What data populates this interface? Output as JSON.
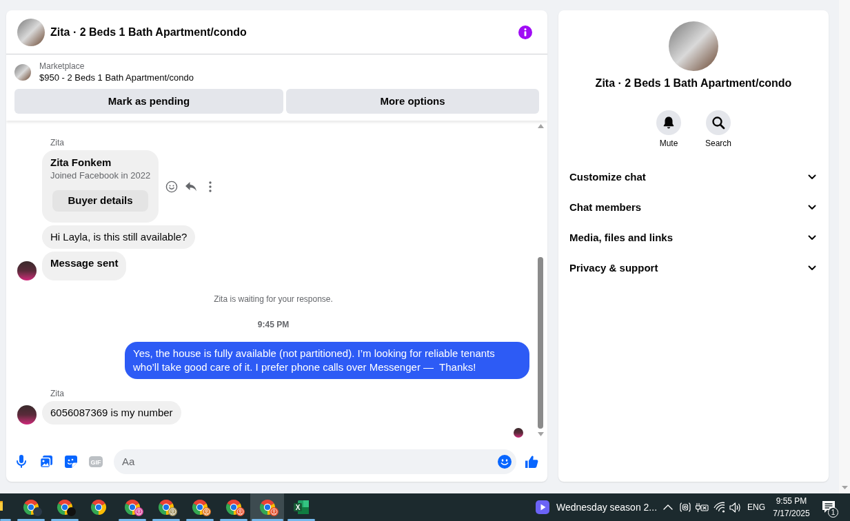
{
  "conversation": {
    "title": "Zita · 2 Beds 1 Bath Apartment/condo"
  },
  "listing": {
    "source": "Marketplace",
    "summary": "$950 - 2 Beds 1 Bath Apartment/condo",
    "actions": [
      "Mark as pending",
      "More options"
    ]
  },
  "messages": [
    {
      "kind": "sender",
      "text": "Zita"
    },
    {
      "kind": "card",
      "title": "Zita Fonkem",
      "subtitle": "Joined Facebook in 2022",
      "button": "Buyer details",
      "hovered": true
    },
    {
      "kind": "incoming",
      "text": "Hi Layla, is this still available?",
      "bold": false,
      "avatar": false,
      "seen": false
    },
    {
      "kind": "incoming",
      "text": "Message sent",
      "bold": true,
      "avatar": true,
      "seen": false
    },
    {
      "kind": "notice",
      "text": "Zita is waiting for your response."
    },
    {
      "kind": "time",
      "text": "9:45 PM"
    },
    {
      "kind": "outgoing",
      "text": "Yes, the house is fully available (not partitioned). I’m looking for reliable tenants who’ll take good care of it. I prefer phone calls over Messenger —  Thanks!"
    },
    {
      "kind": "sender",
      "text": "Zita"
    },
    {
      "kind": "incoming",
      "text": "6056087369 is my number",
      "bold": false,
      "avatar": true,
      "seen": true
    }
  ],
  "composer": {
    "tools": [
      {
        "kind": "voice"
      },
      {
        "kind": "photo"
      },
      {
        "kind": "sticker"
      },
      {
        "kind": "gif",
        "label": "GIF"
      }
    ],
    "placeholder": "Aa"
  },
  "details": {
    "title": "Zita · 2 Beds 1 Bath Apartment/condo",
    "actions": [
      {
        "kind": "mute",
        "label": "Mute"
      },
      {
        "kind": "search",
        "label": "Search"
      }
    ],
    "sections": [
      {
        "label": "Customize chat",
        "expanded": false
      },
      {
        "label": "Chat members",
        "expanded": false
      },
      {
        "label": "Media, files and links",
        "expanded": false
      },
      {
        "label": "Privacy & support",
        "expanded": false
      }
    ]
  },
  "taskbar": {
    "apps": [
      {
        "kind": "folder",
        "running": true,
        "selected": false
      },
      {
        "kind": "browser",
        "badge": {
          "kind": "photo",
          "color": "#2b3a4a"
        },
        "running": true,
        "selected": false
      },
      {
        "kind": "browser",
        "badge": {
          "kind": "photo",
          "color": "#111111"
        },
        "running": true,
        "selected": false
      },
      {
        "kind": "browser",
        "running": false,
        "selected": false
      },
      {
        "kind": "browser",
        "badge": {
          "kind": "profile",
          "color": "#d9449a"
        },
        "running": true,
        "selected": false
      },
      {
        "kind": "browser",
        "badge": {
          "kind": "profile",
          "color": "#a29565"
        },
        "running": true,
        "selected": false
      },
      {
        "kind": "browser",
        "badge": {
          "kind": "profile",
          "color": "#e07b2a"
        },
        "running": true,
        "selected": false
      },
      {
        "kind": "browser",
        "badge": {
          "kind": "profile",
          "color": "#e8512f"
        },
        "running": true,
        "selected": false
      },
      {
        "kind": "browser",
        "badge": {
          "kind": "profile",
          "color": "#e34a26"
        },
        "running": true,
        "selected": true
      },
      {
        "kind": "spreadsheet",
        "letter": "X",
        "running": true,
        "selected": false
      }
    ],
    "tray": {
      "media_title": "Wednesday season 2...",
      "language": "ENG",
      "time": "9:55 PM",
      "date": "7/17/2025",
      "notification_count": "1"
    }
  }
}
